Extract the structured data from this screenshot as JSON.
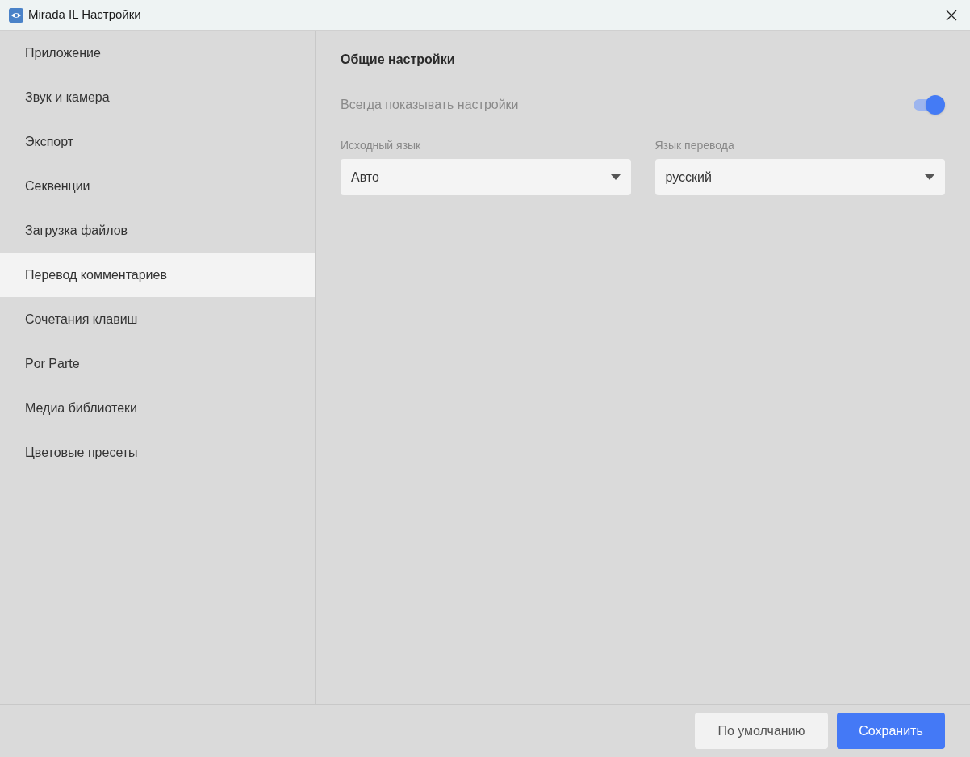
{
  "window": {
    "title": "Mirada IL Настройки"
  },
  "sidebar": {
    "items": [
      {
        "label": "Приложение",
        "selected": false
      },
      {
        "label": "Звук и камера",
        "selected": false
      },
      {
        "label": "Экспорт",
        "selected": false
      },
      {
        "label": "Секвенции",
        "selected": false
      },
      {
        "label": "Загрузка файлов",
        "selected": false
      },
      {
        "label": "Перевод комментариев",
        "selected": true
      },
      {
        "label": "Сочетания клавиш",
        "selected": false
      },
      {
        "label": "Por Parte",
        "selected": false
      },
      {
        "label": "Медиа библиотеки",
        "selected": false
      },
      {
        "label": "Цветовые пресеты",
        "selected": false
      }
    ]
  },
  "content": {
    "heading": "Общие настройки",
    "toggle": {
      "label": "Всегда показывать настройки",
      "on": true
    },
    "selects": [
      {
        "label": "Исходный язык",
        "value": "Авто"
      },
      {
        "label": "Язык перевода",
        "value": "русский"
      }
    ]
  },
  "footer": {
    "buttons": [
      {
        "label": "По умолчанию",
        "kind": "secondary"
      },
      {
        "label": "Сохранить",
        "kind": "primary"
      }
    ]
  }
}
